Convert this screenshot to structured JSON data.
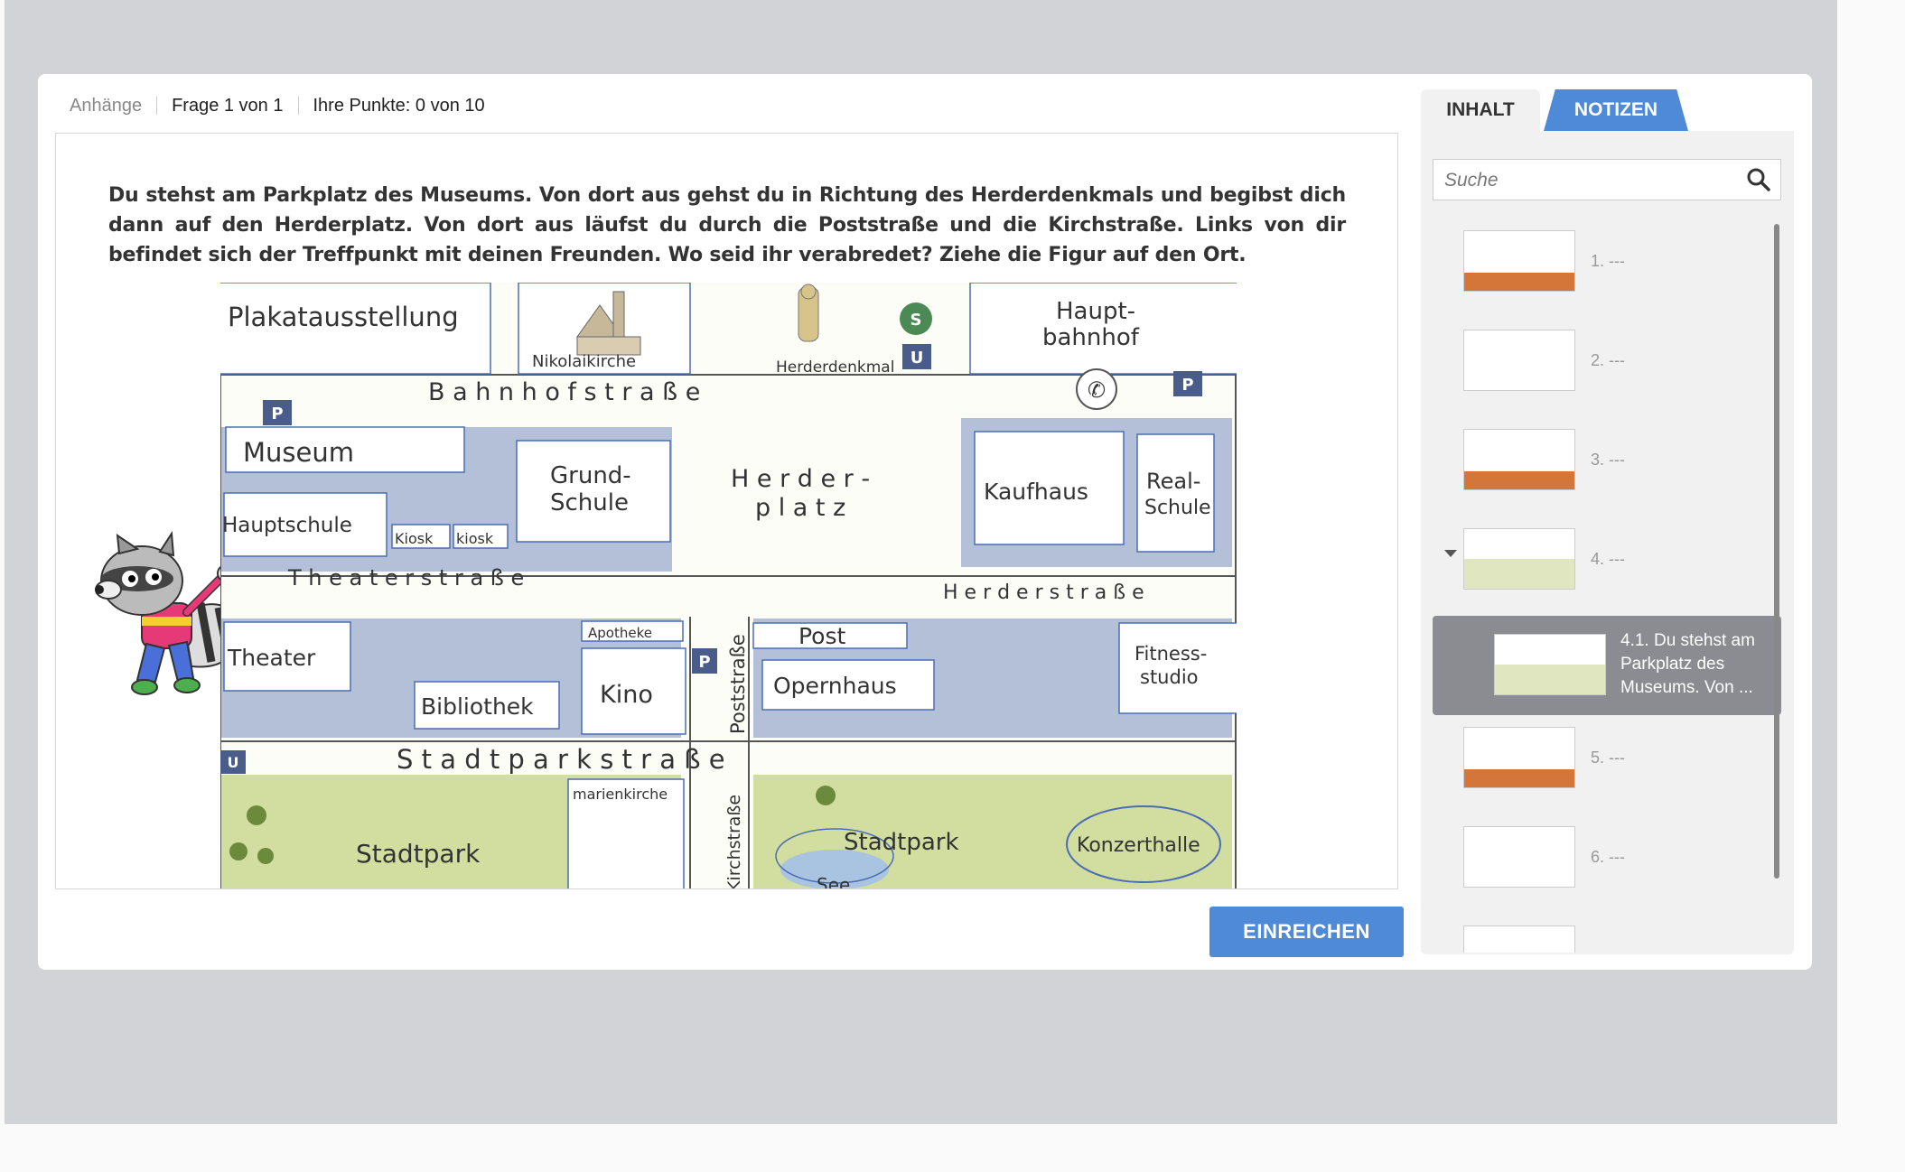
{
  "infobar": {
    "attachments": "Anhänge",
    "question_counter": "Frage 1 von 1",
    "points": "Ihre Punkte: 0 von 10"
  },
  "question": {
    "text": "Du stehst am Parkplatz des Museums. Von dort aus gehst du in Richtung des Herderdenkmals und begibst dich dann auf den Herderplatz. Von dort aus läufst du durch die Poststraße und die Kirchstraße. Links von dir befindet sich der Treffpunkt mit deinen Freunden. Wo seid ihr verabredet? Ziehe die Figur auf den Ort."
  },
  "map": {
    "labels": {
      "plakat": "Plakatausstellung",
      "nikolai": "Nikolaikirche",
      "denkmal": "Herderdenkmal",
      "hbf": [
        "Haupt-",
        "bahnhof"
      ],
      "bahnhofstrasse": "B a h n h o f s t r a ß e",
      "museum": "Museum",
      "grundschule": [
        "Grund-",
        "Schule"
      ],
      "herderplatz": [
        "H e r d e r -",
        "p l a t z"
      ],
      "kaufhaus": "Kaufhaus",
      "realschule": [
        "Real-",
        "Schule"
      ],
      "hauptschule": "Hauptschule",
      "kiosk1": "Kiosk",
      "kiosk2": "kiosk",
      "theaterstrasse": "T h e a t e r s t r a ß e",
      "herderstrasse": "H e r d e r s t r a ß e",
      "theater": "Theater",
      "apotheke": "Apotheke",
      "post": "Post",
      "fitness": [
        "Fitness-",
        "studio"
      ],
      "oper": "Opernhaus",
      "bibliothek": "Bibliothek",
      "kino": "Kino",
      "poststrasse": "Poststraße",
      "stadtparkstrasse": "S t a d t p a r k s t r a ß e",
      "stadtpark1": "Stadtpark",
      "marienkirche": "marienkirche",
      "kirchstrasse": "Kirchstraße",
      "stadtpark2": "Stadtpark",
      "konzerthalle": "Konzerthalle",
      "see": "See",
      "parking": "P",
      "subway": "U",
      "sbahn": "S"
    }
  },
  "submit_label": "EINREICHEN",
  "sidebar": {
    "tab_contents": "INHALT",
    "tab_notes": "NOTIZEN",
    "search_placeholder": "Suche",
    "items": [
      {
        "label": "1. ---"
      },
      {
        "label": "2. ---"
      },
      {
        "label": "3. ---"
      },
      {
        "label": "4. ---"
      },
      {
        "label": "4.1. Du stehst am Parkplatz des Museums. Von ..."
      },
      {
        "label": "5. ---"
      },
      {
        "label": "6. ---"
      }
    ]
  },
  "colors": {
    "accent": "#4e8ad8",
    "active_item": "#8a8c91",
    "background": "#d2d3d6"
  }
}
